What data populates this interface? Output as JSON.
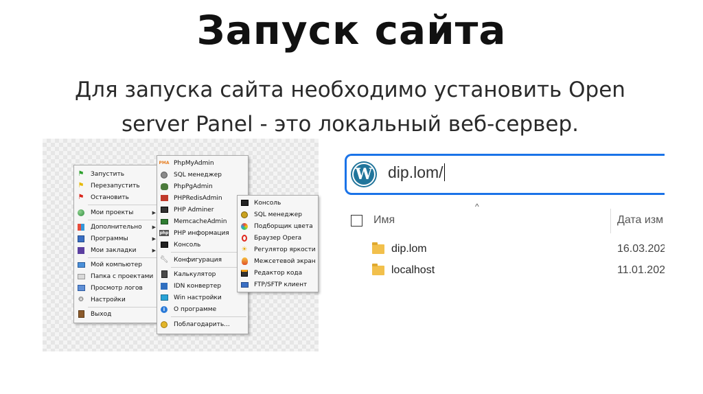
{
  "slide": {
    "title": "Запуск сайта",
    "subtitle_line1": "Для запуска сайта необходимо установить Open",
    "subtitle_line2": "server Panel - это локальный веб-сервер."
  },
  "main_menu": {
    "items": [
      {
        "label": "Запустить",
        "icon": "green-flag-icon"
      },
      {
        "label": "Перезапустить",
        "icon": "yellow-flag-icon"
      },
      {
        "label": "Остановить",
        "icon": "red-flag-icon"
      },
      {
        "label": "Мои проекты",
        "icon": "globe-icon"
      },
      {
        "label": "Дополнительно",
        "icon": "blocks-icon"
      },
      {
        "label": "Программы",
        "icon": "programs-icon"
      },
      {
        "label": "Мои закладки",
        "icon": "bookmarks-icon"
      },
      {
        "label": "Мой компьютер",
        "icon": "computer-icon"
      },
      {
        "label": "Папка с проектами",
        "icon": "folder-icon"
      },
      {
        "label": "Просмотр логов",
        "icon": "log-icon"
      },
      {
        "label": "Настройки",
        "icon": "gear-icon"
      },
      {
        "label": "Выход",
        "icon": "exit-icon"
      }
    ]
  },
  "extra_menu": {
    "items": [
      {
        "label": "PhpMyAdmin",
        "icon": "phpmyadmin-icon"
      },
      {
        "label": "SQL менеджер",
        "icon": "database-icon"
      },
      {
        "label": "PhpPgAdmin",
        "icon": "elephant-icon"
      },
      {
        "label": "PHPRedisAdmin",
        "icon": "redis-icon"
      },
      {
        "label": "PHP Adminer",
        "icon": "adminer-icon"
      },
      {
        "label": "MemcacheAdmin",
        "icon": "memcache-icon"
      },
      {
        "label": "PHP информация",
        "icon": "php-icon"
      },
      {
        "label": "Консоль",
        "icon": "console-icon"
      },
      {
        "label": "Конфигурация",
        "icon": "wrench-icon"
      },
      {
        "label": "Калькулятор",
        "icon": "calculator-icon"
      },
      {
        "label": "IDN конвертер",
        "icon": "converter-icon"
      },
      {
        "label": "Win настройки",
        "icon": "window-settings-icon"
      },
      {
        "label": "О программе",
        "icon": "info-icon"
      },
      {
        "label": "Поблагодарить...",
        "icon": "coin-icon"
      }
    ]
  },
  "programs_menu": {
    "items": [
      {
        "label": "Консоль",
        "icon": "console-icon"
      },
      {
        "label": "SQL менеджер",
        "icon": "database-icon"
      },
      {
        "label": "Подборщик цвета",
        "icon": "color-picker-icon"
      },
      {
        "label": "Браузер Opera",
        "icon": "opera-icon"
      },
      {
        "label": "Регулятор яркости",
        "icon": "brightness-icon"
      },
      {
        "label": "Межсетевой экран",
        "icon": "firewall-icon"
      },
      {
        "label": "Редактор кода",
        "icon": "code-editor-icon"
      },
      {
        "label": "FTP/SFTP клиент",
        "icon": "ftp-icon"
      }
    ]
  },
  "browser": {
    "url": "dip.lom/"
  },
  "explorer": {
    "column_name": "Имя",
    "column_date": "Дата изм",
    "files": [
      {
        "name": "dip.lom",
        "date": "16.03.202"
      },
      {
        "name": "localhost",
        "date": "11.01.202"
      }
    ]
  },
  "colors": {
    "accent_blue": "#1a73e8",
    "folder_yellow": "#f2c04c",
    "wordpress_blue": "#21759b"
  }
}
